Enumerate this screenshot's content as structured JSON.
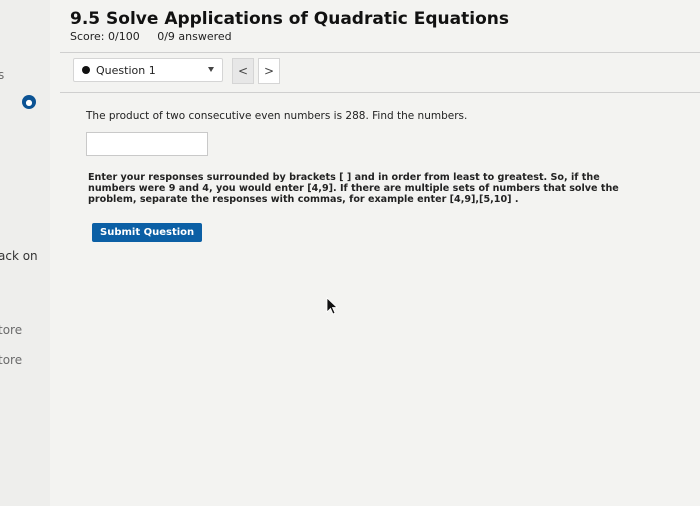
{
  "header": {
    "title": "9.5 Solve Applications of Quadratic Equations",
    "score": "Score: 0/100",
    "answered": "0/9 answered"
  },
  "left_strip": {
    "partial_s": "s",
    "back_on": "ack on",
    "store_1": "tore",
    "store_2": "tore"
  },
  "question_nav": {
    "selected": "Question 1",
    "prev_symbol": "<",
    "next_symbol": ">"
  },
  "question": {
    "text": "The product of two consecutive even numbers is 288.  Find the numbers.",
    "answer_value": "",
    "instructions": "Enter your responses surrounded by brackets [ ] and in order from least to greatest.  So, if the numbers were 9 and 4, you would enter [4,9].  If there are multiple sets of numbers that solve the problem, separate the responses with commas, for example enter [4,9],[5,10]  ."
  },
  "submit_label": "Submit Question",
  "colors": {
    "accent": "#0b5fa5",
    "background": "#f3f3f1"
  }
}
